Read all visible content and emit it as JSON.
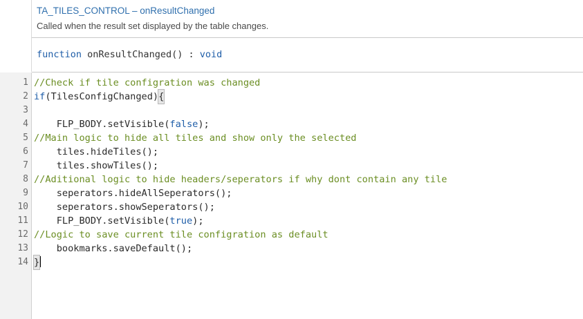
{
  "header": {
    "title": "TA_TILES_CONTROL – onResultChanged",
    "description": "Called when the result set displayed by the table changes."
  },
  "signature": {
    "keyword": "function",
    "name": " onResultChanged() : ",
    "return_type": "void"
  },
  "editor": {
    "line_numbers": [
      "1",
      "2",
      "3",
      "4",
      "5",
      "6",
      "7",
      "8",
      "9",
      "10",
      "11",
      "12",
      "13",
      "14"
    ],
    "lines": {
      "l1": "//Check if tile configration was changed",
      "l2_keyword": "if",
      "l2_rest": "(TilesConfigChanged)",
      "l2_brace": "{",
      "l3": "",
      "l4_pre": "    FLP_BODY.setVisible(",
      "l4_lit": "false",
      "l4_post": ");",
      "l5": "//Main logic to hide all tiles and show only the selected",
      "l6": "    tiles.hideTiles();",
      "l7": "    tiles.showTiles();",
      "l8": "//Aditional logic to hide headers/seperators if why dont contain any tile",
      "l9": "    seperators.hideAllSeperators();",
      "l10": "    seperators.showSeperators();",
      "l11_pre": "    FLP_BODY.setVisible(",
      "l11_lit": "true",
      "l11_post": ");",
      "l12": "//Logic to save current tile configration as default",
      "l13": "    bookmarks.saveDefault();",
      "l14_brace": "}"
    }
  },
  "colors": {
    "title": "#2f6fad",
    "keyword": "#1f5ea8",
    "comment": "#6b8e23",
    "gutter_bg": "#f2f2f2"
  }
}
